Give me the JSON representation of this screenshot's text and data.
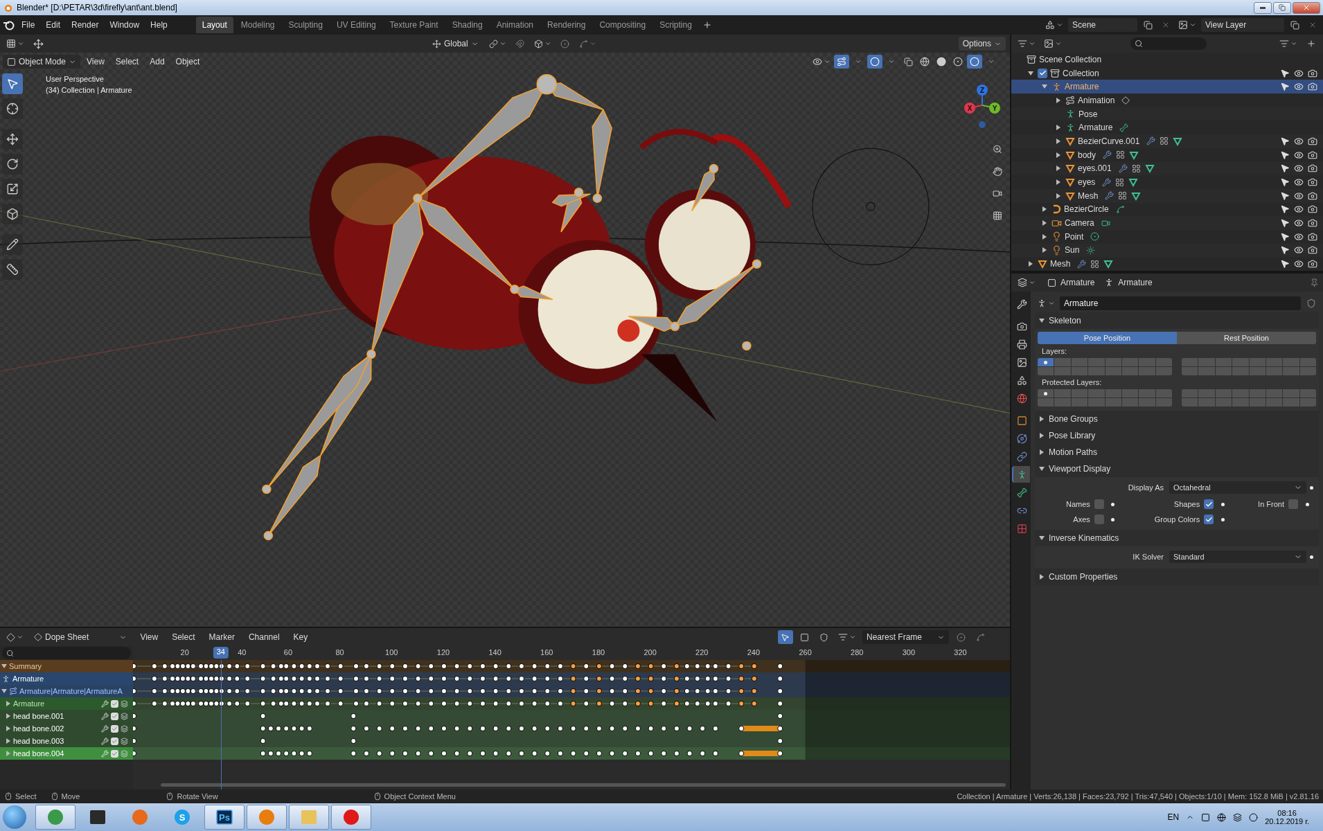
{
  "window": {
    "title": "Blender* [D:\\PETAR\\3d\\firefly\\ant\\ant.blend]"
  },
  "menu": [
    "File",
    "Edit",
    "Render",
    "Window",
    "Help"
  ],
  "workspaces": [
    {
      "label": "Layout",
      "selected": true
    },
    {
      "label": "Modeling",
      "selected": false
    },
    {
      "label": "Sculpting",
      "selected": false
    },
    {
      "label": "UV Editing",
      "selected": false
    },
    {
      "label": "Texture Paint",
      "selected": false
    },
    {
      "label": "Shading",
      "selected": false
    },
    {
      "label": "Animation",
      "selected": false
    },
    {
      "label": "Rendering",
      "selected": false
    },
    {
      "label": "Compositing",
      "selected": false
    },
    {
      "label": "Scripting",
      "selected": false
    }
  ],
  "scene": {
    "scene": "Scene",
    "view_layer": "View Layer"
  },
  "tool_header": {
    "orientation": "Global",
    "options": "Options"
  },
  "viewport": {
    "mode": "Object Mode",
    "menu": [
      "View",
      "Select",
      "Add",
      "Object"
    ],
    "overlay_lines": [
      "User Perspective",
      "(34) Collection | Armature"
    ],
    "gizmo": [
      {
        "label": "Z",
        "color": "#2f72e0"
      },
      {
        "label": "X",
        "color": "#e0364e"
      },
      {
        "label": "Y",
        "color": "#6fb82a"
      }
    ]
  },
  "outliner": {
    "root": "Scene Collection",
    "items": [
      {
        "name": "Collection",
        "kind": "collection",
        "checked": true,
        "expanded": true,
        "selected": false,
        "toggles": true,
        "children": [
          {
            "name": "Armature",
            "kind": "armature",
            "expanded": true,
            "selected": true,
            "toggles": true,
            "children": [
              {
                "name": "Animation",
                "kind": "action",
                "expanded": false,
                "selected": false,
                "toggles": false,
                "badges": [
                  {
                    "kind": "action"
                  }
                ]
              },
              {
                "name": "Pose",
                "kind": "pose",
                "selected": false,
                "toggles": false
              },
              {
                "name": "Armature",
                "kind": "armature_data",
                "expanded": false,
                "selected": false,
                "toggles": false,
                "badges": [
                  {
                    "kind": "bone"
                  }
                ]
              },
              {
                "name": "BezierCurve.001",
                "kind": "mesh",
                "expanded": false,
                "selected": false,
                "toggles": true,
                "badges": [
                  {
                    "kind": "modifier"
                  },
                  {
                    "kind": "particles"
                  },
                  {
                    "kind": "mesh_data"
                  }
                ]
              },
              {
                "name": "body",
                "kind": "mesh",
                "expanded": false,
                "selected": false,
                "toggles": true,
                "badges": [
                  {
                    "kind": "modifier"
                  },
                  {
                    "kind": "particles"
                  },
                  {
                    "kind": "mesh_data"
                  }
                ]
              },
              {
                "name": "eyes.001",
                "kind": "mesh",
                "expanded": false,
                "selected": false,
                "toggles": true,
                "badges": [
                  {
                    "kind": "modifier"
                  },
                  {
                    "kind": "particles"
                  },
                  {
                    "kind": "mesh_data"
                  }
                ]
              },
              {
                "name": "eyes",
                "kind": "mesh",
                "expanded": false,
                "selected": false,
                "toggles": true,
                "badges": [
                  {
                    "kind": "modifier"
                  },
                  {
                    "kind": "particles"
                  },
                  {
                    "kind": "mesh_data"
                  }
                ]
              },
              {
                "name": "Mesh",
                "kind": "mesh",
                "expanded": false,
                "selected": false,
                "toggles": true,
                "badges": [
                  {
                    "kind": "modifier"
                  },
                  {
                    "kind": "particles"
                  },
                  {
                    "kind": "mesh_data"
                  }
                ]
              }
            ]
          },
          {
            "name": "BezierCircle",
            "kind": "curve",
            "expanded": false,
            "selected": false,
            "toggles": true,
            "badges": [
              {
                "kind": "curve_data"
              }
            ]
          },
          {
            "name": "Camera",
            "kind": "camera",
            "expanded": false,
            "selected": false,
            "toggles": true,
            "badges": [
              {
                "kind": "camera_data"
              }
            ]
          },
          {
            "name": "Point",
            "kind": "light",
            "expanded": false,
            "selected": false,
            "toggles": true,
            "badges": [
              {
                "kind": "light_data"
              }
            ]
          },
          {
            "name": "Sun",
            "kind": "light",
            "expanded": false,
            "selected": false,
            "toggles": true,
            "badges": [
              {
                "kind": "sun_data"
              }
            ]
          }
        ]
      },
      {
        "name": "Mesh",
        "kind": "mesh",
        "expanded": false,
        "selected": false,
        "toggles": true,
        "badges": [
          {
            "kind": "modifier"
          },
          {
            "kind": "particles"
          },
          {
            "kind": "mesh_data"
          }
        ]
      }
    ]
  },
  "properties": {
    "header": [
      {
        "kind": "object",
        "label": "Armature"
      },
      {
        "kind": "armature",
        "label": "Armature"
      }
    ],
    "tabs": [
      {
        "kind": "tool",
        "selected": false
      },
      {
        "kind": "render",
        "selected": false
      },
      {
        "kind": "output",
        "selected": false
      },
      {
        "kind": "view_layer",
        "selected": false
      },
      {
        "kind": "scene",
        "selected": false
      },
      {
        "kind": "world",
        "selected": false
      },
      {
        "kind": "object",
        "selected": false
      },
      {
        "kind": "physics",
        "selected": false
      },
      {
        "kind": "constraints",
        "selected": false
      },
      {
        "kind": "data",
        "selected": true
      },
      {
        "kind": "bone",
        "selected": false
      },
      {
        "kind": "bone_constraints",
        "selected": false
      },
      {
        "kind": "texture",
        "selected": false
      }
    ],
    "datablock": "Armature",
    "panels": [
      {
        "kind": "skeleton",
        "title": "Skeleton",
        "expanded": true,
        "positions": [
          {
            "label": "Pose Position",
            "selected": true
          },
          {
            "label": "Rest Position",
            "selected": false
          }
        ],
        "layers": {
          "label": "Layers:",
          "on": [
            true,
            false,
            false,
            false,
            false,
            false,
            false,
            false,
            false,
            false,
            false,
            false,
            false,
            false,
            false,
            false,
            false,
            false,
            false,
            false,
            false,
            false,
            false,
            false,
            false,
            false,
            false,
            false,
            false,
            false,
            false,
            false
          ],
          "used": [
            true,
            false,
            false,
            false,
            false,
            false,
            false,
            false,
            false,
            false,
            false,
            false,
            false,
            false,
            false,
            false,
            false,
            false,
            false,
            false,
            false,
            false,
            false,
            false,
            false,
            false,
            false,
            false,
            false,
            false,
            false,
            false
          ]
        },
        "protected": {
          "label": "Protected Layers:",
          "on": [
            false,
            false,
            false,
            false,
            false,
            false,
            false,
            false,
            false,
            false,
            false,
            false,
            false,
            false,
            false,
            false,
            false,
            false,
            false,
            false,
            false,
            false,
            false,
            false,
            false,
            false,
            false,
            false,
            false,
            false,
            false,
            false
          ],
          "used": [
            true,
            false,
            false,
            false,
            false,
            false,
            false,
            false,
            false,
            false,
            false,
            false,
            false,
            false,
            false,
            false,
            false,
            false,
            false,
            false,
            false,
            false,
            false,
            false,
            false,
            false,
            false,
            false,
            false,
            false,
            false,
            false
          ]
        }
      },
      {
        "kind": "plain",
        "title": "Bone Groups",
        "expanded": false
      },
      {
        "kind": "plain",
        "title": "Pose Library",
        "expanded": false
      },
      {
        "kind": "plain",
        "title": "Motion Paths",
        "expanded": false
      },
      {
        "kind": "fields",
        "title": "Viewport Display",
        "expanded": true,
        "fields": [
          {
            "kind": "select",
            "label": "Display As",
            "value": "Octahedral"
          },
          {
            "kind": "checks",
            "items": [
              {
                "label": "Names",
                "checked": false
              },
              {
                "label": "Shapes",
                "checked": true
              },
              {
                "label": "In Front",
                "checked": false
              },
              {
                "label": "Axes",
                "checked": false
              },
              {
                "label": "Group Colors",
                "checked": true
              }
            ]
          }
        ]
      },
      {
        "kind": "fields",
        "title": "Inverse Kinematics",
        "expanded": true,
        "fields": [
          {
            "kind": "select",
            "label": "IK Solver",
            "value": "Standard"
          }
        ]
      },
      {
        "kind": "plain",
        "title": "Custom Properties",
        "expanded": false
      }
    ]
  },
  "dopesheet": {
    "editor": "Dope Sheet",
    "menu": [
      "View",
      "Select",
      "Marker",
      "Channel",
      "Key"
    ],
    "snap": "Nearest Frame",
    "ruler": [
      "20",
      "40",
      "60",
      "80",
      "100",
      "120",
      "140",
      "160",
      "180",
      "200",
      "220",
      "240",
      "260",
      "280",
      "300",
      "320"
    ],
    "current_frame": {
      "label": "34",
      "level": 0.1133
    },
    "channels": [
      {
        "kind": "summary",
        "name": "Summary",
        "expanded": true,
        "track": {
          "kind": "dense"
        },
        "selected": false
      },
      {
        "kind": "object",
        "name": "Armature",
        "track": {
          "kind": "dense"
        },
        "selected": false
      },
      {
        "kind": "action",
        "name": "Armature|Armature|ArmatureA",
        "expanded": true,
        "track": {
          "kind": "dense"
        },
        "selected": false
      },
      {
        "kind": "group",
        "name": "Armature",
        "expanded": false,
        "track": {
          "kind": "dense"
        },
        "selected": false
      },
      {
        "kind": "bone",
        "name": "head bone.001",
        "expanded": false,
        "track": {
          "kind": "sparse"
        },
        "selected": false
      },
      {
        "kind": "bone",
        "name": "head bone.002",
        "expanded": false,
        "track": {
          "kind": "hold"
        },
        "selected": false
      },
      {
        "kind": "bone",
        "name": "head bone.003",
        "expanded": false,
        "track": {
          "kind": "sparse"
        },
        "selected": false
      },
      {
        "kind": "bone",
        "name": "head bone.004",
        "expanded": false,
        "track": {
          "kind": "hold"
        },
        "selected": true
      }
    ]
  },
  "status_bar": {
    "hints": [
      {
        "label": "Select"
      },
      {
        "label": "Move"
      },
      {
        "label": "Rotate View"
      },
      {
        "label": "Object Context Menu"
      }
    ],
    "stats": "Collection | Armature | Verts:26,138 | Faces:23,792 | Tris:47,540 | Objects:1/10 | Mem: 152.8 MiB | v2.81.16"
  },
  "taskbar": {
    "apps": [
      {
        "kind": "chrome",
        "selected": true
      },
      {
        "kind": "dark",
        "selected": false
      },
      {
        "kind": "firefox",
        "selected": false
      },
      {
        "kind": "skype",
        "label": "S",
        "selected": false
      },
      {
        "kind": "photoshop",
        "label": "Ps",
        "selected": true
      },
      {
        "kind": "blender",
        "selected": true
      },
      {
        "kind": "folder",
        "selected": true
      },
      {
        "kind": "splat",
        "selected": true
      }
    ],
    "language": "EN",
    "time": "08:16",
    "date": "20.12.2019 г."
  }
}
